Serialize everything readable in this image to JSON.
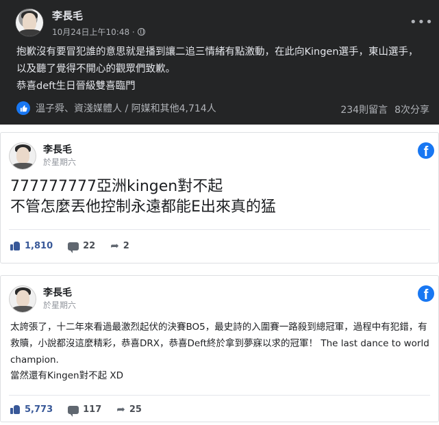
{
  "dark_post": {
    "author": "李長毛",
    "timestamp": "10月24日上午10:48 ·",
    "privacy_icon": "globe-icon",
    "more_icon": "more-dots-icon",
    "more_label": "•••",
    "text": "抱歉沒有要冒犯誰的意思就是播到讓二追三情緒有點激動，在此向Kingen選手，東山選手，以及聽了覺得不開心的觀眾們致歉。",
    "text2": "恭喜deft生日晉級雙喜臨門",
    "reaction_icon": "like-icon",
    "reactions": "溫子舜、資淺媒體人 / 阿媒和其他4,714人",
    "comments": "234則留言",
    "shares": "8次分享",
    "accent": "#1877f2",
    "background": "#242526"
  },
  "post1": {
    "author": "李長毛",
    "time": "於星期六",
    "brand_icon": "facebook-icon",
    "brand_letter": "f",
    "line1": "777777777亞洲kingen對不起",
    "line2": "不管怎麼丟他控制永遠都能E出來真的猛",
    "likes": "1,810",
    "comments": "22",
    "shares": "2"
  },
  "post2": {
    "author": "李長毛",
    "time": "於星期六",
    "brand_icon": "facebook-icon",
    "brand_letter": "f",
    "text": "太誇張了，十二年來看過最激烈起伏的決賽BO5，最史詩的入圍賽一路殺到總冠軍，過程中有犯錯，有救贖，小說都沒這麼精彩，恭喜DRX，恭喜Deft終於拿到夢寐以求的冠軍！ The last dance to world champion.",
    "text2": "當然還有Kingen對不起 XD",
    "likes": "5,773",
    "comments": "117",
    "shares": "25"
  }
}
